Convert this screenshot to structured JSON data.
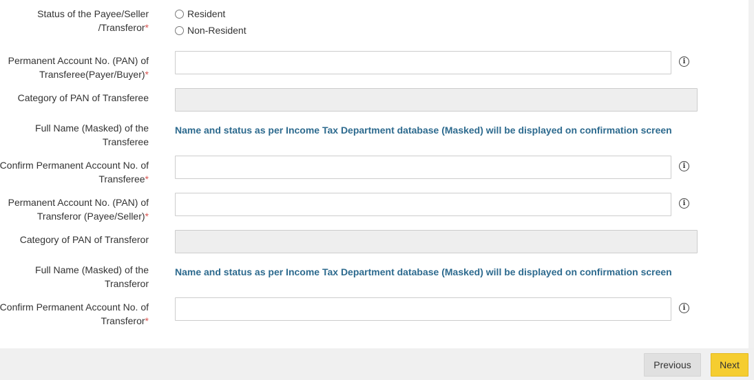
{
  "form": {
    "status": {
      "label_line1": "Status of the Payee/Seller",
      "label_line2": "/Transferor",
      "required": "*",
      "options": [
        "Resident",
        "Non-Resident"
      ]
    },
    "pan_transferee": {
      "label_line1": "Permanent Account No. (PAN) of",
      "label_line2": "Transferee(Payer/Buyer)",
      "required": "*",
      "value": "",
      "info_icon": "info-icon"
    },
    "category_transferee": {
      "label_line1": "Category of PAN of Transferee",
      "value": ""
    },
    "name_transferee": {
      "label_line1": "Full Name (Masked) of the",
      "label_line2": "Transferee",
      "note": "Name and status as per Income Tax Department database (Masked) will be displayed on confirmation screen"
    },
    "confirm_pan_transferee": {
      "label_line1": "Confirm Permanent Account No. of",
      "label_line2": "Transferee",
      "required": "*",
      "value": "",
      "info_icon": "info-icon"
    },
    "pan_transferor": {
      "label_line1": "Permanent Account No. (PAN) of",
      "label_line2": "Transferor (Payee/Seller)",
      "required": "*",
      "value": "",
      "info_icon": "info-icon"
    },
    "category_transferor": {
      "label_line1": "Category of PAN of Transferor",
      "value": ""
    },
    "name_transferor": {
      "label_line1": "Full Name (Masked) of the",
      "label_line2": "Transferor",
      "note": "Name and status as per Income Tax Department database (Masked) will be displayed on confirmation screen"
    },
    "confirm_pan_transferor": {
      "label_line1": "Confirm Permanent Account No. of",
      "label_line2": "Transferor",
      "required": "*",
      "value": "",
      "info_icon": "info-icon"
    }
  },
  "footer": {
    "previous_label": "Previous",
    "next_label": "Next"
  },
  "info_glyph": "i",
  "colors": {
    "required": "#d9534f",
    "note": "#2d6a8e",
    "next_button": "#f5cd30",
    "previous_button": "#e0e0e0"
  }
}
